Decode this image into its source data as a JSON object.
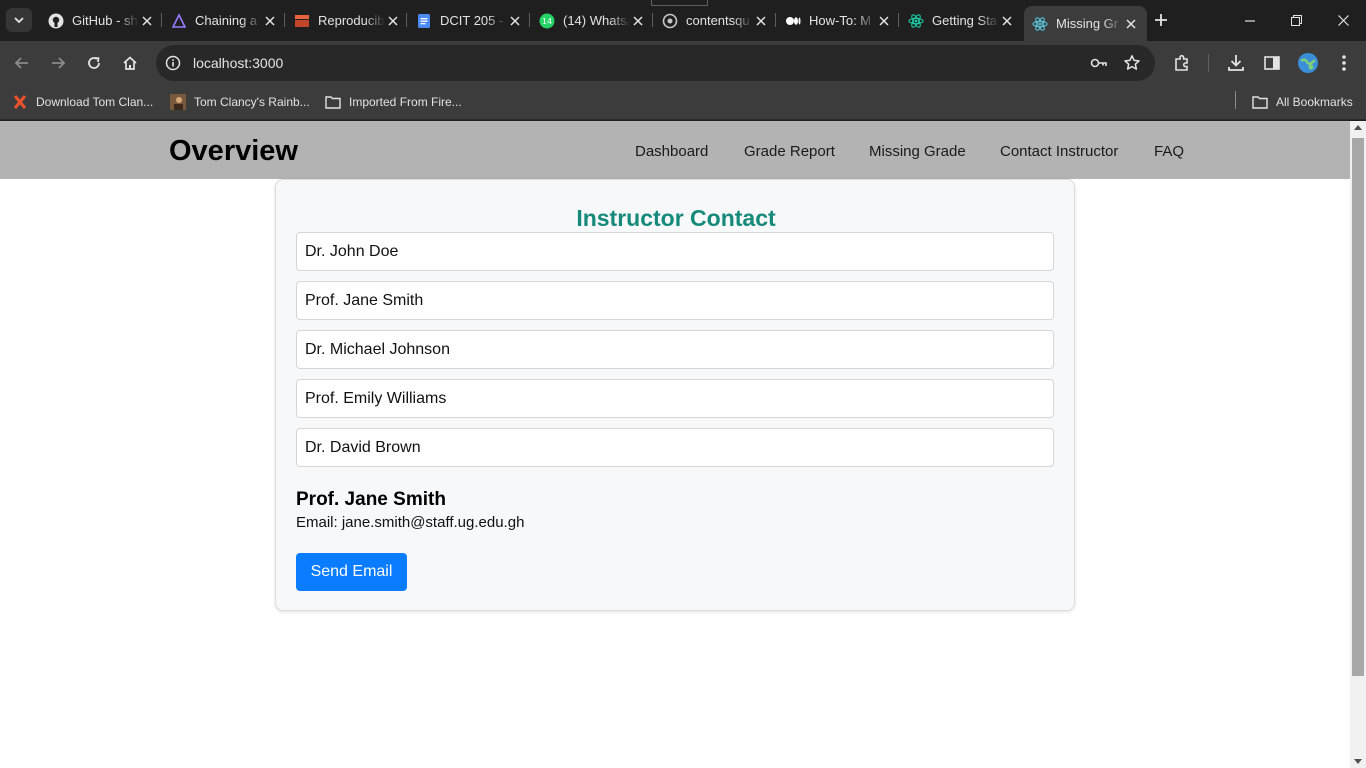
{
  "browser": {
    "tabs": [
      {
        "title": "GitHub - sh",
        "icon": "github-icon"
      },
      {
        "title": "Chaining a",
        "icon": "triangle-logo-icon"
      },
      {
        "title": "Reproducib",
        "icon": "bookmark-logo-icon"
      },
      {
        "title": "DCIT 205 -",
        "icon": "google-docs-icon"
      },
      {
        "title": "(14) WhatsA",
        "icon": "whatsapp-icon",
        "badge": "14"
      },
      {
        "title": "contentsqu",
        "icon": "globe-icon"
      },
      {
        "title": "How-To: M",
        "icon": "medium-icon"
      },
      {
        "title": "Getting Sta",
        "icon": "react-icon"
      },
      {
        "title": "Missing Gr",
        "icon": "react-icon",
        "active": true
      }
    ],
    "url": "localhost:3000",
    "bookmarks": [
      {
        "label": "Download Tom Clan...",
        "icon": "x-logo-icon"
      },
      {
        "label": "Tom Clancy's Rainb...",
        "icon": "game-thumbnail-icon"
      },
      {
        "label": "Imported From Fire...",
        "icon": "folder-icon"
      }
    ],
    "all_bookmarks_label": "All Bookmarks",
    "accent_color": "#3c3c3c"
  },
  "app": {
    "title": "Overview",
    "nav": [
      "Dashboard",
      "Grade Report",
      "Missing Grade",
      "Contact Instructor",
      "FAQ"
    ],
    "card_title": "Instructor Contact",
    "instructors": [
      "Dr. John Doe",
      "Prof. Jane Smith",
      "Dr. Michael Johnson",
      "Prof. Emily Williams",
      "Dr. David Brown"
    ],
    "selected": {
      "name": "Prof. Jane Smith",
      "email_text": "Email: jane.smith@staff.ug.edu.gh"
    },
    "send_label": "Send Email",
    "colors": {
      "header_bg": "#b3b3b3",
      "title_teal": "#168a7a",
      "button_blue": "#0a7cff"
    }
  }
}
